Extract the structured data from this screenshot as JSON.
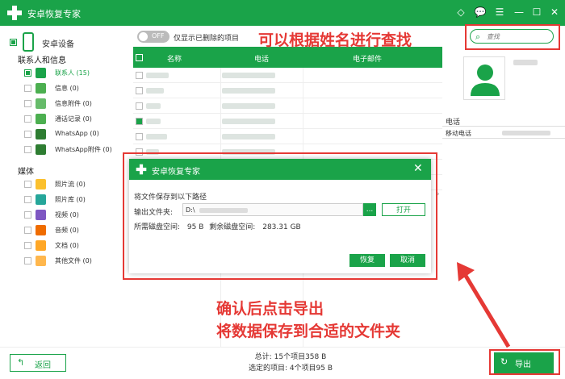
{
  "app": {
    "title": "安卓恢复专家"
  },
  "sidebar": {
    "device": "安卓设备",
    "sections": [
      {
        "title": "联系人和信息",
        "items": [
          {
            "label": "联系人 (15)",
            "icon": "contacts-icon",
            "color": "#1aa349",
            "active": true
          },
          {
            "label": "信息 (0)",
            "icon": "message-icon",
            "color": "#4caf50",
            "active": false
          },
          {
            "label": "信息附件 (0)",
            "icon": "attachment-icon",
            "color": "#66bb6a",
            "active": false
          },
          {
            "label": "通话记录 (0)",
            "icon": "phone-icon",
            "color": "#4caf50",
            "active": false
          },
          {
            "label": "WhatsApp (0)",
            "icon": "whatsapp-icon",
            "color": "#2e7d32",
            "active": false
          },
          {
            "label": "WhatsApp附件 (0)",
            "icon": "whatsapp-attachment-icon",
            "color": "#2e7d32",
            "active": false
          }
        ]
      },
      {
        "title": "媒体",
        "items": [
          {
            "label": "照片流 (0)",
            "icon": "photostream-icon",
            "color": "#fbc02d",
            "active": false
          },
          {
            "label": "照片库 (0)",
            "icon": "photo-library-icon",
            "color": "#26a69a",
            "active": false
          },
          {
            "label": "视频 (0)",
            "icon": "video-icon",
            "color": "#7e57c2",
            "active": false
          },
          {
            "label": "音频 (0)",
            "icon": "audio-icon",
            "color": "#ef6c00",
            "active": false
          },
          {
            "label": "文档 (0)",
            "icon": "document-icon",
            "color": "#ffa726",
            "active": false
          },
          {
            "label": "其他文件 (0)",
            "icon": "other-files-icon",
            "color": "#ffb74d",
            "active": false
          }
        ]
      }
    ]
  },
  "toolbar": {
    "toggle": "OFF",
    "toggle_label": "仅显示已删除的项目"
  },
  "search": {
    "placeholder": "查找"
  },
  "table": {
    "columns": [
      "名称",
      "电话",
      "电子邮件"
    ],
    "rows": [
      {
        "checked": false
      },
      {
        "checked": false
      },
      {
        "checked": false
      },
      {
        "checked": true
      },
      {
        "checked": false
      },
      {
        "checked": false
      },
      {
        "checked": false
      },
      {
        "checked": true
      }
    ]
  },
  "detail": {
    "section": "电话",
    "label": "移动电话"
  },
  "dialog": {
    "title": "安卓恢复专家",
    "prompt": "将文件保存到以下路径",
    "folder_label": "输出文件夹:",
    "folder_value": "D:\\",
    "browse": "...",
    "open": "打开",
    "space_label": "所需磁盘空间:",
    "space_required": "95 B",
    "space_free_label": "剩余磁盘空间:",
    "space_free": "283.31 GB",
    "restore": "恢复",
    "cancel": "取消"
  },
  "footer": {
    "back": "返回",
    "total": "总计: 15个项目358 B",
    "selected": "选定的项目: 4个项目95 B",
    "export": "导出"
  },
  "annotations": {
    "search_hint": "可以根据姓名进行查找",
    "export_hint_1": "确认后点击导出",
    "export_hint_2": "将数据保存到合适的文件夹"
  },
  "colors": {
    "accent": "#1aa349",
    "annotation": "#e53935"
  }
}
